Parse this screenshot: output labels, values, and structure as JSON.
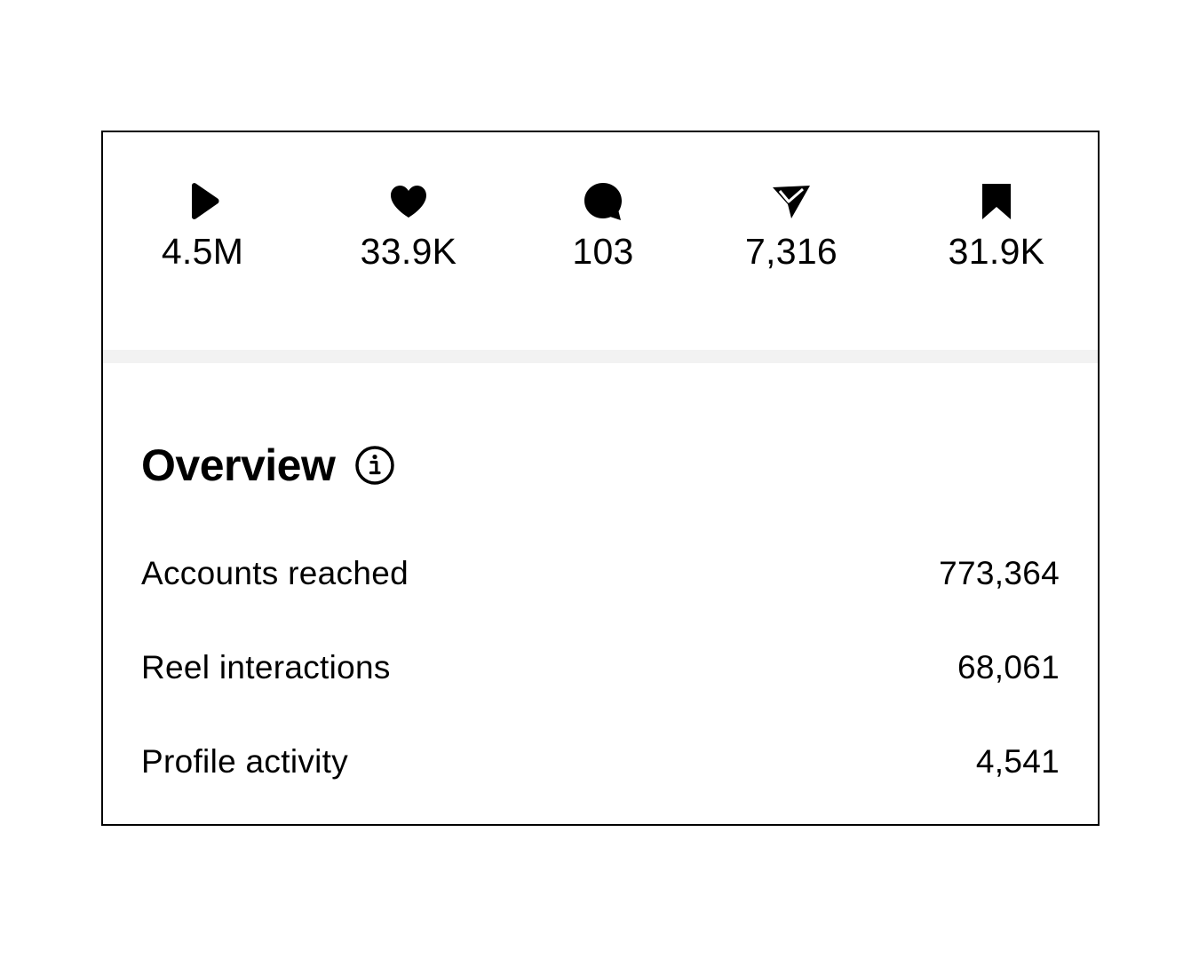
{
  "stats": [
    {
      "icon": "play-icon",
      "value": "4.5M"
    },
    {
      "icon": "heart-icon",
      "value": "33.9K"
    },
    {
      "icon": "comment-icon",
      "value": "103"
    },
    {
      "icon": "share-icon",
      "value": "7,316"
    },
    {
      "icon": "bookmark-icon",
      "value": "31.9K"
    }
  ],
  "overview": {
    "title": "Overview",
    "info_icon": "info-icon",
    "rows": [
      {
        "label": "Accounts reached",
        "value": "773,364"
      },
      {
        "label": "Reel interactions",
        "value": "68,061"
      },
      {
        "label": "Profile activity",
        "value": "4,541"
      }
    ]
  },
  "colors": {
    "text": "#000000",
    "divider": "#f2f2f2",
    "background": "#ffffff"
  }
}
